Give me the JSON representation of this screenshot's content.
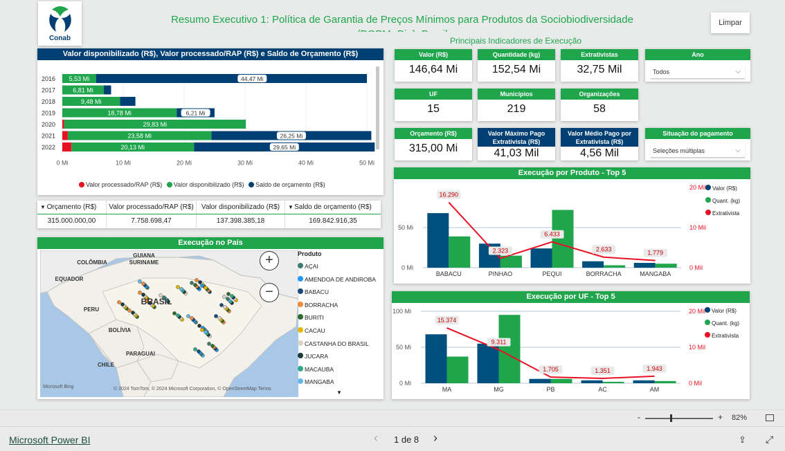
{
  "header": {
    "title": "Resumo Executivo 1: Política de Garantia de Preços Mínimos para Produtos da Sociobiodiversidade (PGPM- Bio): Brasil",
    "subtitle": "Principais Indicadores de Execução",
    "logo_text": "Conab",
    "clear_button": "Limpar"
  },
  "bar_chart": {
    "title": "Valor disponibilizado (R$), Valor processado/RAP (R$) e Saldo de Orçamento (R$)",
    "legend": [
      "Valor processado/RAP (R$)",
      "Valor disponibilizado (R$)",
      "Saldo de orçamento (R$)"
    ],
    "colors": {
      "processado": "#e81123",
      "disponibilizado": "#1fa64c",
      "saldo": "#003f73"
    }
  },
  "totals_table": {
    "headers": [
      "Orçamento (R$)",
      "Valor processado/RAP (R$)",
      "Valor disponibilizado (R$)",
      "Saldo de orçamento (R$)"
    ],
    "values": [
      "315.000.000,00",
      "7.758.698,47",
      "137.398.385,18",
      "169.842.916,35"
    ]
  },
  "kpis": [
    {
      "label": "Valor (R$)",
      "value": "146,64 Mi"
    },
    {
      "label": "Quantidade (kg)",
      "value": "152,54 Mi"
    },
    {
      "label": "Extrativistas",
      "value": "32,75 Mil"
    },
    {
      "label": "UF",
      "value": "15"
    },
    {
      "label": "Municípios",
      "value": "219"
    },
    {
      "label": "Organizações",
      "value": "58"
    },
    {
      "label": "Orçamento (R$)",
      "value": "315,00 Mi"
    },
    {
      "label": "Valor Máximo Pago Extrativista (R$)",
      "value": "41,03 Mil"
    },
    {
      "label": "Valor Médio Pago por Extrativista (R$)",
      "value": "4,56 Mil"
    }
  ],
  "slicers": {
    "ano": {
      "label": "Ano",
      "value": "Todos"
    },
    "situacao": {
      "label": "Situação do pagamento",
      "value": "Seleções múltiplas"
    }
  },
  "map": {
    "title": "Execução no País",
    "labels": [
      "GUIANA",
      "SURINAME",
      "COLÔMBIA",
      "EQUADOR",
      "PERU",
      "BRASIL",
      "BOLÍVIA",
      "PARAGUAI",
      "CHILE"
    ],
    "attribution": "© 2024 TomTom, © 2024 Microsoft Corporation, © OpenStreetMap  Terms",
    "bing": "Microsoft Bing",
    "legend_title": "Produto",
    "products": [
      {
        "name": "AÇAI",
        "color": "#3c7d6e"
      },
      {
        "name": "AMENDOA DE ANDIROBA",
        "color": "#2196f3"
      },
      {
        "name": "BABACU",
        "color": "#1a4a7a"
      },
      {
        "name": "BORRACHA",
        "color": "#f08a3c"
      },
      {
        "name": "BURITI",
        "color": "#2e6b2e"
      },
      {
        "name": "CACAU",
        "color": "#e8b400"
      },
      {
        "name": "CASTANHA DO BRASIL",
        "color": "#d9d3c7"
      },
      {
        "name": "JUCARA",
        "color": "#1b3b3b"
      },
      {
        "name": "MACAUBA",
        "color": "#2ea88a"
      },
      {
        "name": "MANGABA",
        "color": "#63b6e6"
      }
    ]
  },
  "produto_chart": {
    "title": "Execução por Produto - Top 5",
    "legend": [
      "Valor (R$)",
      "Quant. (kg)",
      "Extrativista"
    ]
  },
  "uf_chart": {
    "title": "Execução por UF - Top 5",
    "legend": [
      "Valor (R$)",
      "Quant. (kg)",
      "Extrativista"
    ]
  },
  "chart_data": [
    {
      "type": "bar",
      "orientation": "horizontal-stacked",
      "categories": [
        "2016",
        "2017",
        "2018",
        "2019",
        "2020",
        "2021",
        "2022"
      ],
      "series": [
        {
          "name": "Valor processado/RAP (R$)",
          "values": [
            0,
            0,
            0,
            0,
            0.3,
            0.9,
            1.5
          ]
        },
        {
          "name": "Valor disponibilizado (R$)",
          "values": [
            5.53,
            6.81,
            9.48,
            18.78,
            29.83,
            23.58,
            20.13
          ],
          "labels": [
            "5,53 Mi",
            "6,81 Mi",
            "9,48 Mi",
            "18,78 Mi",
            "29,83 Mi",
            "23,58 Mi",
            "20,13 Mi"
          ]
        },
        {
          "name": "Saldo de orçamento (R$)",
          "values": [
            44.47,
            1.2,
            2.52,
            6.21,
            0,
            26.25,
            29.65
          ],
          "labels": [
            "44,47 Mi",
            "",
            "",
            "6,21 Mi",
            "",
            "26,25 Mi",
            "29,65 Mi"
          ]
        }
      ],
      "xticks": [
        "0 Mi",
        "10 Mi",
        "20 Mi",
        "30 Mi",
        "40 Mi",
        "50 Mi"
      ],
      "xlim": [
        0,
        50
      ]
    },
    {
      "type": "bar",
      "categories": [
        "BABACU",
        "PINHAO",
        "PEQUI",
        "BORRACHA",
        "MANGABA"
      ],
      "series": [
        {
          "name": "Valor (R$)",
          "values": [
            68,
            30,
            24,
            8,
            6
          ]
        },
        {
          "name": "Quant. (kg)",
          "values": [
            39,
            15,
            72,
            3,
            5
          ]
        },
        {
          "name": "Extrativista",
          "values": [
            16290,
            2323,
            6433,
            2633,
            1779
          ],
          "labels": [
            "16.290",
            "2.323",
            "6.433",
            "2.633",
            "1.779"
          ]
        }
      ],
      "y_left_ticks": [
        "0 Mi",
        "50 Mi"
      ],
      "y_right_ticks": [
        "0 Mil",
        "10 Mil",
        "20 Mil"
      ],
      "ylim": [
        0,
        100
      ],
      "y2lim": [
        0,
        20000
      ]
    },
    {
      "type": "bar",
      "categories": [
        "MA",
        "MG",
        "PB",
        "AC",
        "AM"
      ],
      "series": [
        {
          "name": "Valor (R$)",
          "values": [
            68,
            55,
            6,
            4,
            4
          ]
        },
        {
          "name": "Quant. (kg)",
          "values": [
            37,
            95,
            6,
            2,
            3
          ]
        },
        {
          "name": "Extrativista",
          "values": [
            15374,
            9311,
            1705,
            1351,
            1943
          ],
          "labels": [
            "15.374",
            "9.311",
            "1.705",
            "1.351",
            "1.943"
          ]
        }
      ],
      "y_left_ticks": [
        "0 Mi",
        "50 Mi",
        "100 Mi"
      ],
      "y_right_ticks": [
        "0 Mil",
        "10 Mil",
        "20 Mil"
      ],
      "ylim": [
        0,
        100
      ],
      "y2lim": [
        0,
        20000
      ]
    }
  ],
  "zoom": {
    "minus": "-",
    "plus": "+",
    "level": "82%"
  },
  "footer": {
    "brand": "Microsoft Power BI",
    "page": "1 de 8",
    "prev": "‹",
    "next": "›"
  }
}
